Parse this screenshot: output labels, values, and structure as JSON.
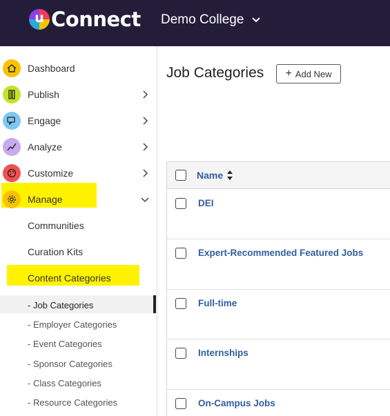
{
  "header": {
    "logo_letter": "u",
    "logo_text": "Connect",
    "college_name": "Demo College",
    "logo_colors": [
      "#f23a5d",
      "#f7c300",
      "#2aa6e0",
      "#8b3fe6"
    ],
    "background_color": "#231d3a"
  },
  "sidebar": {
    "items": [
      {
        "label": "Dashboard",
        "icon": "home-icon",
        "icon_color": "#f7c300",
        "has_chevron": false
      },
      {
        "label": "Publish",
        "icon": "publish-icon",
        "icon_color": "#c6e22a",
        "has_chevron": true
      },
      {
        "label": "Engage",
        "icon": "chat-icon",
        "icon_color": "#7fc7f0",
        "has_chevron": true
      },
      {
        "label": "Analyze",
        "icon": "analytics-icon",
        "icon_color": "#c9a9f0",
        "has_chevron": true
      },
      {
        "label": "Customize",
        "icon": "palette-icon",
        "icon_color": "#f05050",
        "has_chevron": true
      },
      {
        "label": "Manage",
        "icon": "gear-icon",
        "icon_color": "#f7c300",
        "has_chevron": true,
        "expanded": true
      }
    ],
    "manage_subitems": [
      "Communities",
      "Curation Kits",
      "Content Categories"
    ],
    "content_category_items": [
      "- Job Categories",
      "- Employer Categories",
      "- Event Categories",
      "- Sponsor Categories",
      "- Class Categories",
      "- Resource Categories"
    ],
    "active_item": "- Job Categories",
    "highlight_color": "#fff200"
  },
  "main": {
    "title": "Job Categories",
    "add_button_label": "Add New",
    "table": {
      "column_header": "Name",
      "rows": [
        "DEI",
        "Expert-Recommended Featured Jobs",
        "Full-time",
        "Internships",
        "On-Campus Jobs"
      ]
    },
    "link_color": "#2f5f9e"
  }
}
